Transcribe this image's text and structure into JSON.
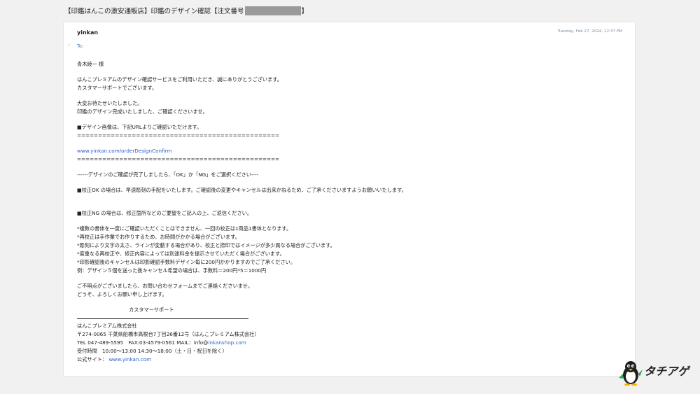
{
  "email": {
    "subject_before": "【印鑑はんこの激安通販店】印鑑のデザイン確認【注文番号",
    "subject_after": "】",
    "sender": "yinkan",
    "date": "Tuesday, Feb 27, 2024, 12:37 PM",
    "to_label": "To:"
  },
  "body": {
    "greeting": "青木綾一 様",
    "p1_l1": "はんこプレミアムのデザイン確認サービスをご利用いただき、誠にありがとうございます。",
    "p1_l2": "カスタマーサポートでございます。",
    "p2_l1": "大変お待たせいたしました。",
    "p2_l2": "印鑑のデザイン完成いたしました、ご確認くださいませ。",
    "p3_l1": "■デザイン画像は、下記URLよりご確認いただけます。",
    "sep": "================================================",
    "url": "www.yinkan.com/orderDesignConfirm",
    "dash_line": "------デザインのご確認が完了しましたら、「OK」か「NG」をご選択ください----",
    "ok_line": "■校正OK の場合は、早速彫刻の手配をいたします。ご確認後の変更やキャンセルは出来かねるため、ご了承くださいますようお願いいたします。",
    "ng_line": "■校正NG の場合は、修正箇所などのご要望をご記入の上、ご返信ください。",
    "notes": [
      "*複数の書体を一度にご確認いただくことはできません、一回の校正は1商品1書体となります。",
      "*再校正は手作業でお作りするため、お時間がかかる場合がございます。",
      "*彫刻により文字の太さ、ラインが変動する場合があり、校正と捺印ではイメージが多少異なる場合がございます。",
      "*度重なる再校正や、修正内容によっては別途料金を提示させていただく場合がございます。",
      "*印影確認後のキャンセルは印影確認手数料デザイン毎に200円かかりますのでご了承ください。",
      "例：デザイン５個を送った後キャンセル希望の場合は、手数料＝200円*5＝1000円"
    ],
    "closing_l1": "ご不明点がございましたら、お問い合わせフォームまでご連絡くださいませ。",
    "closing_l2": "どうぞ、よろしくお願い申し上げます。",
    "sig_title": "カスタマーサポート",
    "company": "はんこプレミアム株式会社",
    "address": "〒274-0065 千葉県船橋市高根台7丁目26番12号（はんこプレミアム株式会社）",
    "contact_prefix": "TEL 047-489-5595　FAX:03-4579-0561 MAIL：info@",
    "contact_email_domain": "inkanshop.com",
    "hours": "受付時間　10:00〜13:00 14:30〜18:00（土・日・祝日を除く）",
    "site_label": "公式サイト：",
    "site_url": "www.yinkan.com"
  },
  "watermark": {
    "text": "タチアゲ",
    "icon": "penguin-mascot-icon"
  }
}
